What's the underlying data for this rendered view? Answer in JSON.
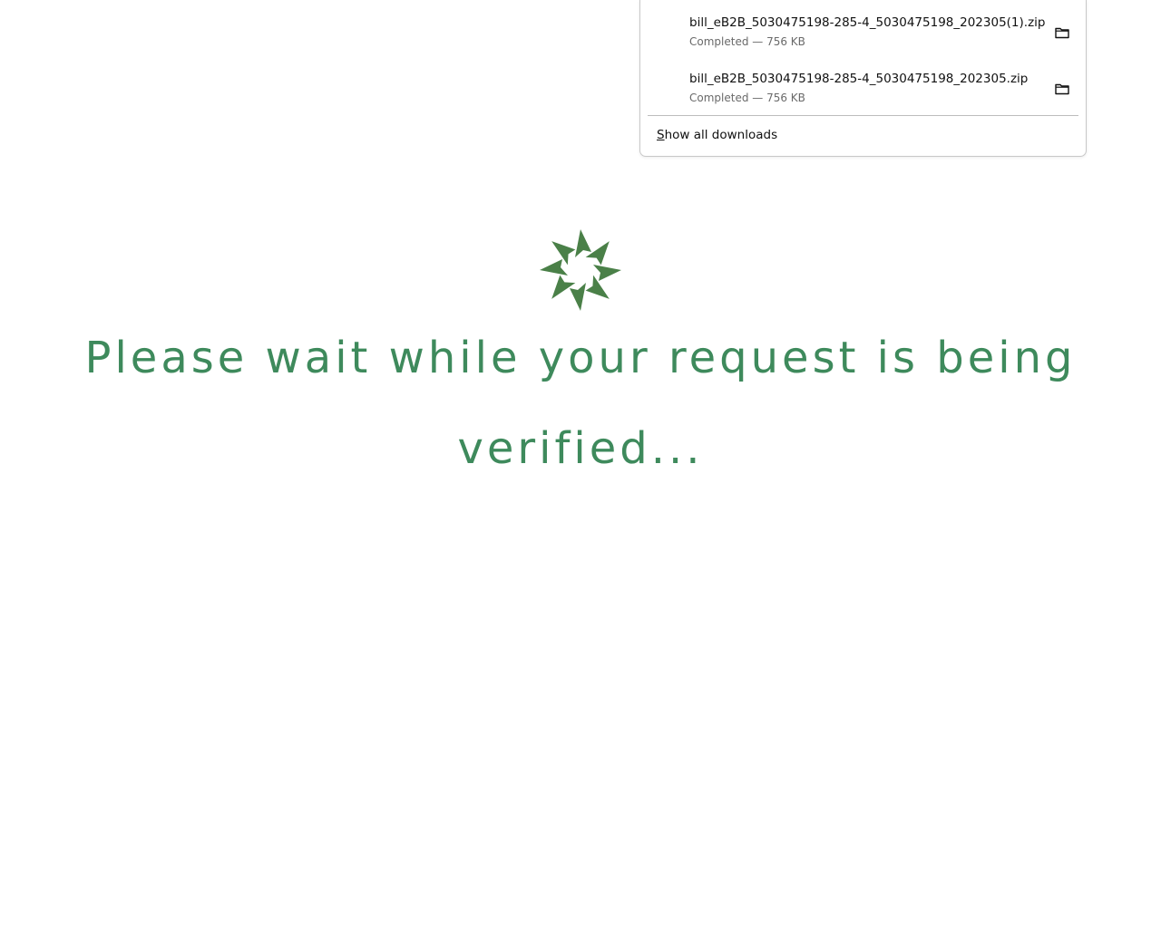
{
  "downloads_panel": {
    "items": [
      {
        "file_name": "bill_eB2B_5030475198-285-4_5030475198_202305(1).zip",
        "status": "Completed — 756 KB",
        "action_icon": "folder-icon"
      },
      {
        "file_name": "bill_eB2B_5030475198-285-4_5030475198_202305.zip",
        "status": "Completed — 756 KB",
        "action_icon": "folder-icon"
      }
    ],
    "show_all_mnemonic": "S",
    "show_all_rest": "how all downloads"
  },
  "loader": {
    "icon": "spinner-icon",
    "color": "#4a8048",
    "message": "Please wait while your request is being verified...",
    "message_color": "#3e8a5c"
  }
}
